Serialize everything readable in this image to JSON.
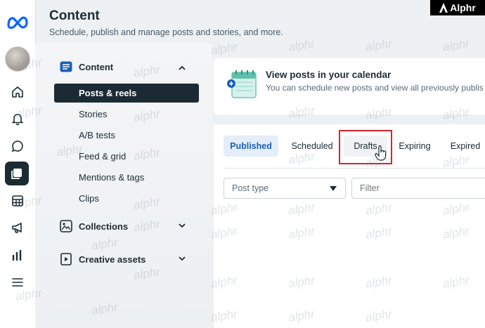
{
  "header": {
    "title": "Content",
    "subtitle": "Schedule, publish and manage posts and stories, and more."
  },
  "brand": {
    "label": "Alphr"
  },
  "rail": {
    "items": [
      "home-icon",
      "bell-icon",
      "chat-bubble-icon",
      "content-icon",
      "table-icon",
      "megaphone-icon",
      "bar-chart-icon",
      "menu-icon"
    ],
    "active": "content-icon"
  },
  "nav": {
    "content_label": "Content",
    "sub_items": [
      "Posts & reels",
      "Stories",
      "A/B tests",
      "Feed & grid",
      "Mentions & tags",
      "Clips"
    ],
    "collections_label": "Collections",
    "creative_label": "Creative assets"
  },
  "calendar_card": {
    "title": "View posts in your calendar",
    "subtitle": "You can schedule new posts and view all previously publis"
  },
  "tabs": [
    "Published",
    "Scheduled",
    "Drafts",
    "Expiring",
    "Expired"
  ],
  "active_tab": "Published",
  "filters": {
    "post_type_label": "Post type",
    "filter_placeholder": "Filter"
  },
  "colors": {
    "accent": "#1b5fb5",
    "highlight": "#d9232a",
    "dark": "#1c2b33"
  },
  "watermark": "alphr"
}
